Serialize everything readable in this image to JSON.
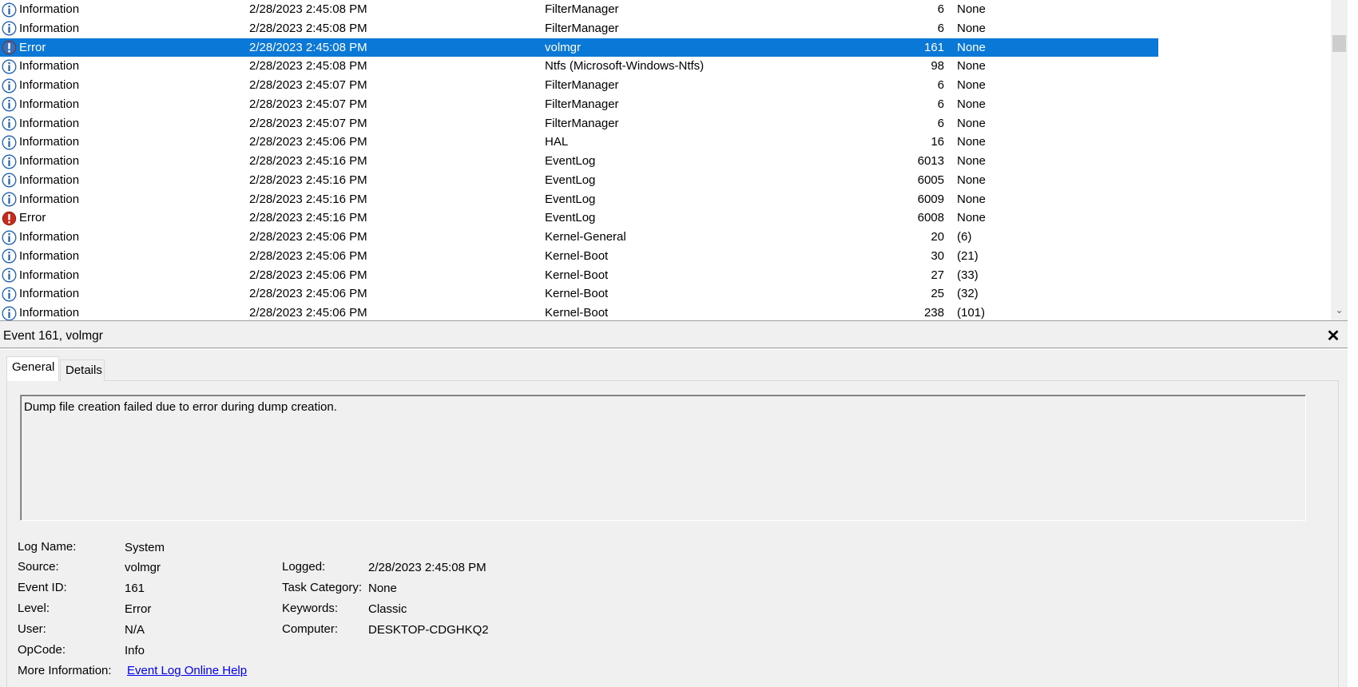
{
  "rows": [
    {
      "level": "Information",
      "date": "2/28/2023 2:45:08 PM",
      "source": "FilterManager",
      "id": "6",
      "category": "None",
      "type": "info"
    },
    {
      "level": "Information",
      "date": "2/28/2023 2:45:08 PM",
      "source": "FilterManager",
      "id": "6",
      "category": "None",
      "type": "info"
    },
    {
      "level": "Error",
      "date": "2/28/2023 2:45:08 PM",
      "source": "volmgr",
      "id": "161",
      "category": "None",
      "type": "error",
      "selected": true
    },
    {
      "level": "Information",
      "date": "2/28/2023 2:45:08 PM",
      "source": "Ntfs (Microsoft-Windows-Ntfs)",
      "id": "98",
      "category": "None",
      "type": "info"
    },
    {
      "level": "Information",
      "date": "2/28/2023 2:45:07 PM",
      "source": "FilterManager",
      "id": "6",
      "category": "None",
      "type": "info"
    },
    {
      "level": "Information",
      "date": "2/28/2023 2:45:07 PM",
      "source": "FilterManager",
      "id": "6",
      "category": "None",
      "type": "info"
    },
    {
      "level": "Information",
      "date": "2/28/2023 2:45:07 PM",
      "source": "FilterManager",
      "id": "6",
      "category": "None",
      "type": "info"
    },
    {
      "level": "Information",
      "date": "2/28/2023 2:45:06 PM",
      "source": "HAL",
      "id": "16",
      "category": "None",
      "type": "info"
    },
    {
      "level": "Information",
      "date": "2/28/2023 2:45:16 PM",
      "source": "EventLog",
      "id": "6013",
      "category": "None",
      "type": "info"
    },
    {
      "level": "Information",
      "date": "2/28/2023 2:45:16 PM",
      "source": "EventLog",
      "id": "6005",
      "category": "None",
      "type": "info"
    },
    {
      "level": "Information",
      "date": "2/28/2023 2:45:16 PM",
      "source": "EventLog",
      "id": "6009",
      "category": "None",
      "type": "info"
    },
    {
      "level": "Error",
      "date": "2/28/2023 2:45:16 PM",
      "source": "EventLog",
      "id": "6008",
      "category": "None",
      "type": "error"
    },
    {
      "level": "Information",
      "date": "2/28/2023 2:45:06 PM",
      "source": "Kernel-General",
      "id": "20",
      "category": "(6)",
      "type": "info"
    },
    {
      "level": "Information",
      "date": "2/28/2023 2:45:06 PM",
      "source": "Kernel-Boot",
      "id": "30",
      "category": "(21)",
      "type": "info"
    },
    {
      "level": "Information",
      "date": "2/28/2023 2:45:06 PM",
      "source": "Kernel-Boot",
      "id": "27",
      "category": "(33)",
      "type": "info"
    },
    {
      "level": "Information",
      "date": "2/28/2023 2:45:06 PM",
      "source": "Kernel-Boot",
      "id": "25",
      "category": "(32)",
      "type": "info"
    },
    {
      "level": "Information",
      "date": "2/28/2023 2:45:06 PM",
      "source": "Kernel-Boot",
      "id": "238",
      "category": "(101)",
      "type": "info"
    }
  ],
  "scrollbar": {
    "down_glyph": "⌄"
  },
  "detail": {
    "title": "Event 161, volmgr",
    "close_glyph": "✕",
    "tabs": [
      "General",
      "Details"
    ],
    "message": "Dump file creation failed due to error during dump creation.",
    "labels": {
      "log_name": "Log Name:",
      "source": "Source:",
      "event_id": "Event ID:",
      "level": "Level:",
      "user": "User:",
      "opcode": "OpCode:",
      "more_info": "More Information:",
      "logged": "Logged:",
      "task_category": "Task Category:",
      "keywords": "Keywords:",
      "computer": "Computer:"
    },
    "values": {
      "log_name": "System",
      "source": "volmgr",
      "event_id": "161",
      "level": "Error",
      "user": "N/A",
      "opcode": "Info",
      "more_info_link": "Event Log Online Help",
      "logged": "2/28/2023 2:45:08 PM",
      "task_category": "None",
      "keywords": "Classic",
      "computer": "DESKTOP-CDGHKQ2"
    }
  },
  "colors": {
    "selection": "#0a78d7",
    "info_icon": "#1c5fb5",
    "error_icon": "#c42b1c"
  }
}
